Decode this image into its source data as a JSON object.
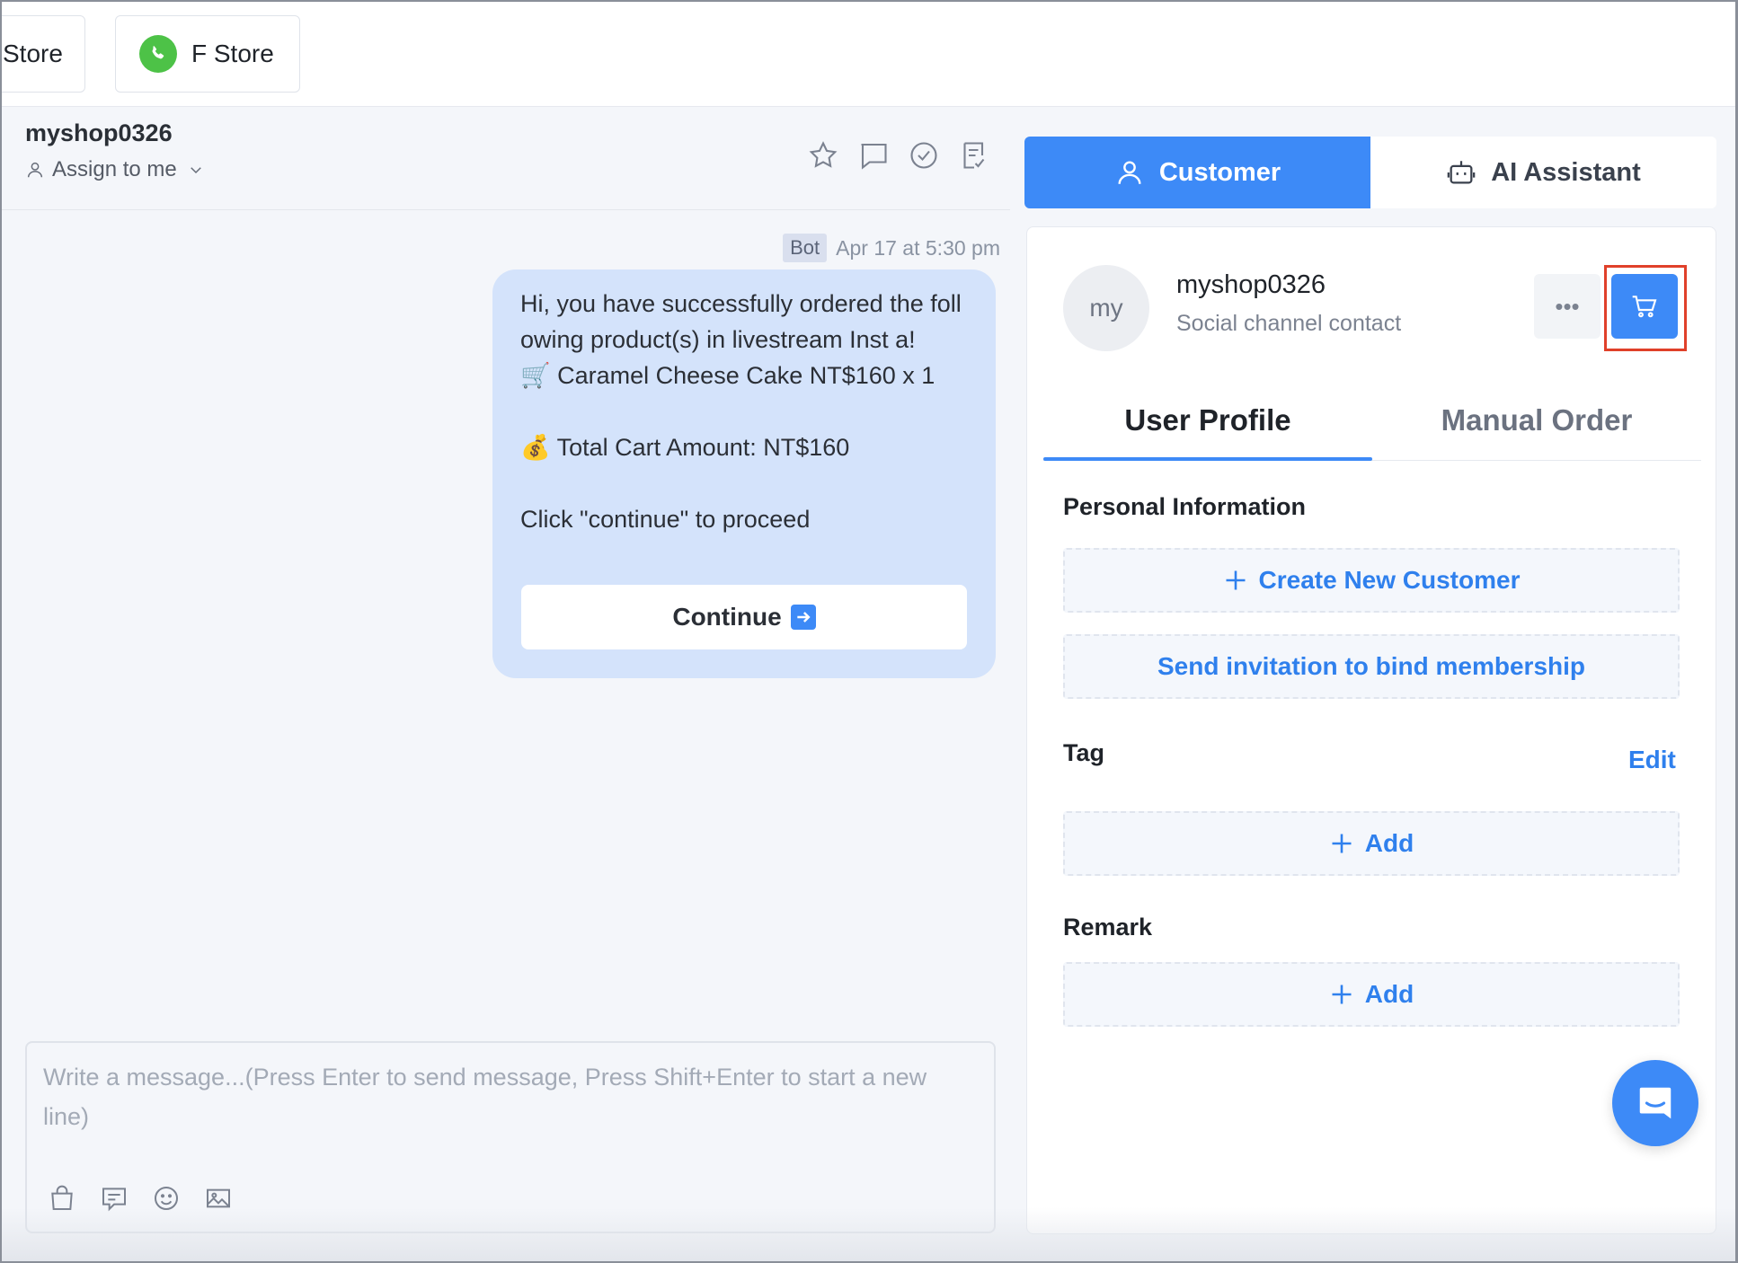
{
  "tabs": [
    {
      "label": "Store"
    },
    {
      "label": "F Store"
    }
  ],
  "chat": {
    "name": "myshop0326",
    "assign_label": "Assign to me",
    "message": {
      "sender_badge": "Bot",
      "timestamp": "Apr 17 at 5:30 pm",
      "text": "Hi, you have successfully ordered the following product(s) in livestream Inst a!\n🛒 Caramel Cheese Cake NT$160 x 1\n\n💰 Total Cart Amount: NT$160\n\nClick \"continue\" to proceed",
      "button_label": "Continue"
    },
    "composer": {
      "placeholder": "Write a message...(Press Enter to send message, Press Shift+Enter to start a new line)"
    }
  },
  "panel": {
    "tabs": [
      {
        "label": "Customer",
        "active": true
      },
      {
        "label": "AI Assistant",
        "active": false
      }
    ],
    "contact": {
      "avatar_initials": "my",
      "name": "myshop0326",
      "subtitle": "Social channel contact"
    },
    "sub_tabs": [
      {
        "label": "User Profile",
        "active": true
      },
      {
        "label": "Manual Order",
        "active": false
      }
    ],
    "personal_info": {
      "title": "Personal Information",
      "create_label": "Create New Customer",
      "invite_label": "Send invitation to bind membership"
    },
    "tag": {
      "title": "Tag",
      "edit_label": "Edit",
      "add_label": "Add"
    },
    "remark": {
      "title": "Remark",
      "add_label": "Add"
    }
  },
  "colors": {
    "accent": "#3d8af7",
    "link": "#2f80ed",
    "highlight_border": "#e0402a",
    "bubble": "#d4e3fb",
    "whatsapp_green": "#4dc247"
  },
  "icons": [
    "whatsapp-icon",
    "user-icon",
    "chevron-down-icon",
    "star-icon",
    "comment-icon",
    "check-circle-icon",
    "note-check-icon",
    "shopping-bag-icon",
    "quick-reply-icon",
    "emoji-icon",
    "image-icon",
    "robot-icon",
    "more-icon",
    "cart-icon",
    "plus-icon",
    "chat-bubble-icon"
  ]
}
